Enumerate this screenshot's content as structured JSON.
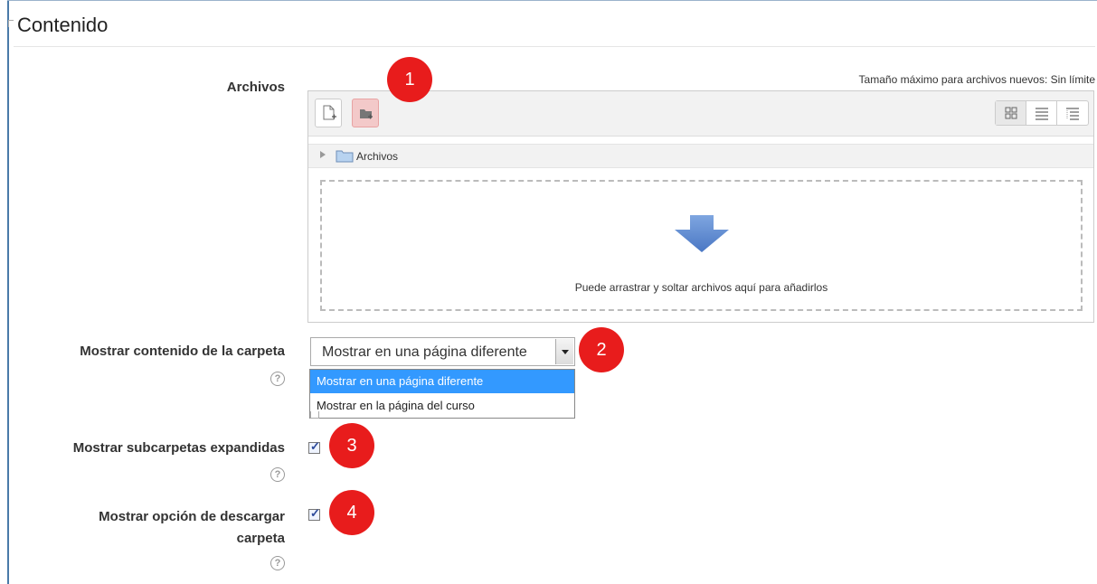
{
  "section": {
    "title": "Contenido"
  },
  "files": {
    "label": "Archivos",
    "max_size": "Tamaño máximo para archivos nuevos: Sin límite",
    "path_label": "Archivos",
    "dropzone_text": "Puede arrastrar y soltar archivos aquí para añadirlos",
    "icons": [
      "add-file-icon",
      "create-folder-icon",
      "icon-view-icon",
      "list-view-icon",
      "tree-view-icon",
      "folder-icon",
      "drop-arrow-icon"
    ]
  },
  "display": {
    "label": "Mostrar contenido de la carpeta",
    "selected": "Mostrar en una página diferente",
    "options": [
      "Mostrar en una página diferente",
      "Mostrar en la página del curso"
    ]
  },
  "expanded": {
    "label": "Mostrar subcarpetas expandidas",
    "checked": true
  },
  "download": {
    "label_line1": "Mostrar opción de descargar",
    "label_line2": "carpeta",
    "checked": true
  },
  "help_glyph": "?",
  "badges": [
    "1",
    "2",
    "3",
    "4"
  ],
  "colors": {
    "badge": "#e81c1c",
    "selected_option": "#3399ff",
    "highlight": "#f3c9c9"
  }
}
